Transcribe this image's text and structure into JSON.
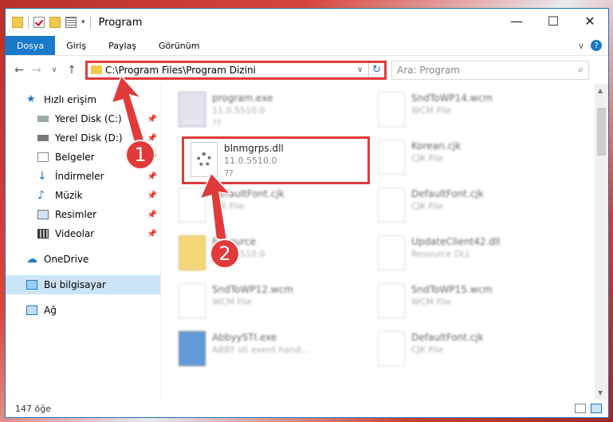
{
  "window": {
    "title": "Program"
  },
  "winctl": {
    "minimize": "—",
    "maximize": "☐",
    "close": "✕"
  },
  "ribbon": {
    "tabs": [
      "Dosya",
      "Giriş",
      "Paylaş",
      "Görünüm"
    ],
    "expand": "∨",
    "help": "?"
  },
  "nav": {
    "back": "←",
    "forward": "→",
    "recent": "∨",
    "up": "↑"
  },
  "address": {
    "path": "C:\\Program Files\\Program Dizini",
    "dropdown": "∨",
    "refresh": "↻"
  },
  "search": {
    "placeholder": "Ara: Program",
    "icon": "⌕"
  },
  "sidebar": {
    "items": [
      {
        "label": "Hızlı erişim",
        "icon": "star-icon"
      },
      {
        "label": "Yerel Disk (C:)",
        "icon": "drive-icon",
        "pin": "📌"
      },
      {
        "label": "Yerel Disk (D:)",
        "icon": "drive-icon",
        "pin": "📌"
      },
      {
        "label": "Belgeler",
        "icon": "documents-icon",
        "pin": "📌"
      },
      {
        "label": "İndirmeler",
        "icon": "download-icon",
        "pin": "📌"
      },
      {
        "label": "Müzik",
        "icon": "music-icon",
        "pin": "📌"
      },
      {
        "label": "Resimler",
        "icon": "pictures-icon",
        "pin": "📌"
      },
      {
        "label": "Videolar",
        "icon": "video-icon",
        "pin": "📌"
      },
      {
        "label": "OneDrive",
        "icon": "cloud-icon"
      },
      {
        "label": "Bu bilgisayar",
        "icon": "computer-icon"
      },
      {
        "label": "Ağ",
        "icon": "network-icon"
      }
    ]
  },
  "files": [
    {
      "name": "program.exe",
      "line2": "11.0.5510.0",
      "line3": "??"
    },
    {
      "name": "SndToWP14.wcm",
      "line2": "WCM File",
      "line3": ""
    },
    {
      "name": "blnmgrps.dll",
      "line2": "11.0.5510.0",
      "line3": "??"
    },
    {
      "name": "Korean.cjk",
      "line2": "CJK File",
      "line3": ""
    },
    {
      "name": "DefaultFont.cjk",
      "line2": "CJK File",
      "line3": ""
    },
    {
      "name": "DefaultFont.cjk",
      "line2": "CJK File",
      "line3": ""
    },
    {
      "name": "Resource",
      "line2": "11.0.5510.0",
      "line3": ""
    },
    {
      "name": "UpdateClient42.dll",
      "line2": "Resource DLL",
      "line3": ""
    },
    {
      "name": "SndToWP12.wcm",
      "line2": "WCM File",
      "line3": ""
    },
    {
      "name": "SndToWP15.wcm",
      "line2": "WCM File",
      "line3": ""
    },
    {
      "name": "AbbyySTI.exe",
      "line2": "ABBY sti event hand...",
      "line3": ""
    },
    {
      "name": "DefaultFont.cjk",
      "line2": "CJK File",
      "line3": ""
    }
  ],
  "status": {
    "count": "147 öğe"
  },
  "callouts": {
    "one": "1",
    "two": "2"
  },
  "colors": {
    "accent": "#1979ca",
    "highlight": "#e03a3a"
  }
}
